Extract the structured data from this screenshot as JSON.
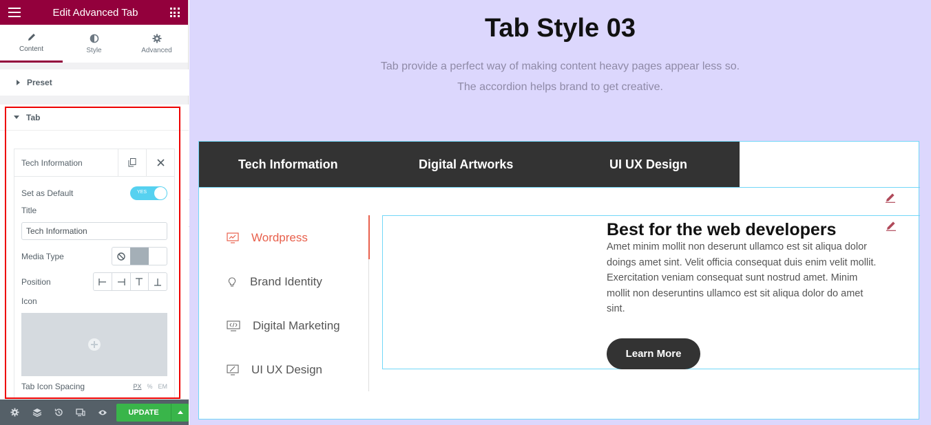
{
  "panel": {
    "header_title": "Edit Advanced Tab",
    "tabs": [
      {
        "label": "Content",
        "icon": "pencil-icon"
      },
      {
        "label": "Style",
        "icon": "half-circle-icon"
      },
      {
        "label": "Advanced",
        "icon": "gear-icon"
      }
    ],
    "preset_label": "Preset",
    "tab_section_label": "Tab",
    "repeater": {
      "item_title": "Tech Information",
      "set_default_label": "Set as Default",
      "toggle_text": "YES",
      "title_label": "Title",
      "title_value": "Tech Information",
      "media_type_label": "Media Type",
      "position_label": "Position",
      "icon_label": "Icon",
      "spacing_label": "Tab Icon Spacing",
      "units": [
        "PX",
        "%",
        "EM"
      ]
    },
    "update_label": "UPDATE"
  },
  "preview": {
    "title": "Tab Style 03",
    "subtitle_line1": "Tab provide a perfect way of making content heavy pages appear less so.",
    "subtitle_line2": "The accordion helps brand to get creative.",
    "top_tabs": [
      "Tech Information",
      "Digital Artworks",
      "UI UX Design"
    ],
    "side_items": [
      "Wordpress",
      "Brand Identity",
      "Digital Marketing",
      "UI UX Design"
    ],
    "content_title": "Best for the web developers",
    "content_text": "Amet minim mollit non deserunt ullamco est sit aliqua dolor doings amet sint. Velit officia consequat duis enim velit mollit. Exercitation veniam consequat sunt nostrud amet. Minim mollit non deseruntins ullamco est sit aliqua dolor do amet sint.",
    "learn_more": "Learn More"
  },
  "colors": {
    "brand": "#93003c",
    "accent": "#e8604c",
    "update_green": "#39b54a",
    "preview_bg": "#dcd7fd"
  }
}
